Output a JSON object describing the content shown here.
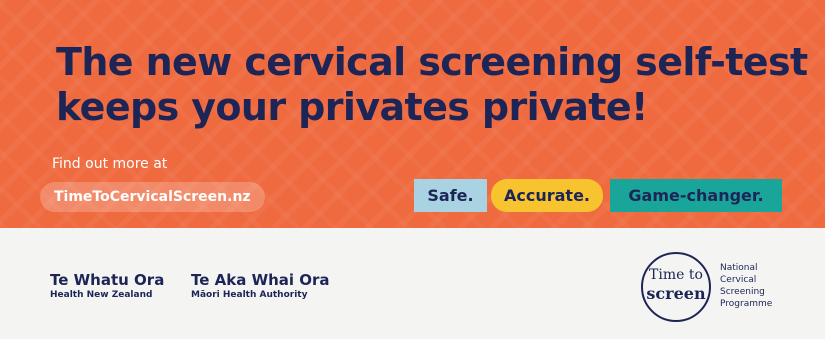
{
  "headline": {
    "line1": "The new cervical screening self-test",
    "line2": "keeps your privates private!"
  },
  "cta": {
    "find_out": "Find out more at",
    "url": "TimeToCervicalScreen.nz"
  },
  "tags": [
    {
      "label": "Safe.",
      "color": "#a9d3e3"
    },
    {
      "label": "Accurate.",
      "color": "#f7c32e"
    },
    {
      "label": "Game-changer.",
      "color": "#1aa59b"
    }
  ],
  "orgs": [
    {
      "name": "Te Whatu Ora",
      "sub": "Health New Zealand"
    },
    {
      "name": "Te Aka Whai Ora",
      "sub": "Māori Health Authority"
    }
  ],
  "logo": {
    "line1": "Time to",
    "line2": "screen",
    "programme": [
      "National",
      "Cervical",
      "Screening",
      "Programme"
    ]
  },
  "colors": {
    "orange": "#ef6a3f",
    "navy": "#1d2557",
    "light_bg": "#f4f4f2"
  }
}
